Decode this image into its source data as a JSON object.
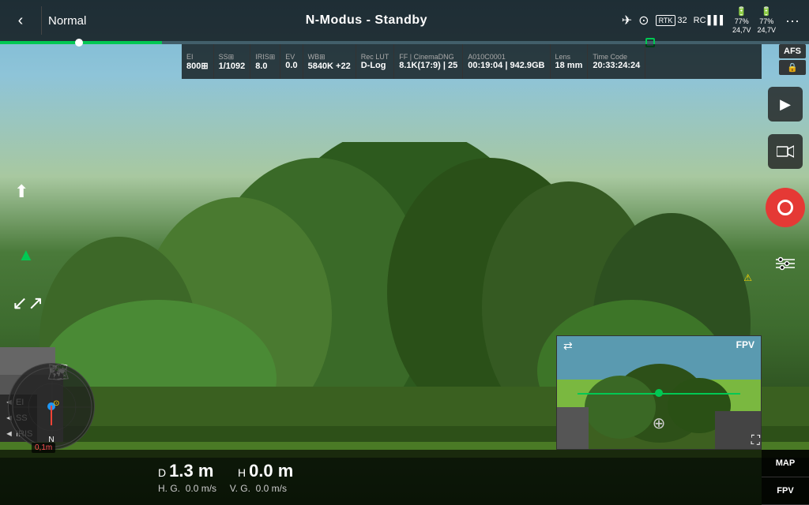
{
  "header": {
    "back_label": "‹",
    "mode_label": "Normal",
    "title": "N-Modus - Standby",
    "rtk_value": "32",
    "rc_label": "RC",
    "battery1_pct": "77%",
    "battery1_v": "24,7V",
    "battery2_pct": "77%",
    "battery2_v": "24,7V",
    "menu_dots": "···"
  },
  "params": {
    "ei_label": "EI",
    "ei_value": "800⊞",
    "ss_label": "SS⊞",
    "ss_value": "1/1092",
    "iris_label": "IRIS⊞",
    "iris_value": "8.0",
    "ev_label": "EV",
    "ev_value": "0.0",
    "wb_label": "WB⊞",
    "wb_value": "5840K +22",
    "reclut_label": "Rec LUT",
    "reclut_value": "D-Log",
    "ff_label": "FF | CinemaDNG",
    "ff_value": "8.1K(17:9) | 25",
    "clip_label": "A010C0001",
    "clip_value": "00:19:04 | 942.9GB",
    "lens_label": "Lens",
    "lens_value": "18 mm",
    "tc_label": "Time Code",
    "tc_value": "20:33:24:24",
    "afs_label": "AFS",
    "ae_lock_icon": "🔒"
  },
  "telemetry": {
    "d_label": "D",
    "d_value": "1.3 m",
    "h_label": "H",
    "h_value": "0.0 m",
    "hg_label": "H. G.",
    "hg_value": "0.0 m/s",
    "vg_label": "V. G.",
    "vg_value": "0.0 m/s",
    "dist_warning": "0,1m"
  },
  "miniview": {
    "label": "FPV",
    "switch_icon": "⇄"
  },
  "map_fpv": {
    "map_label": "MAP",
    "fpv_label": "FPV"
  },
  "icons": {
    "back": "‹",
    "play": "▶",
    "camera": "📷",
    "settings": "⚙",
    "north": "▲",
    "upload": "⬆",
    "route": "↙↗",
    "map": "⊞",
    "record_dot": "●",
    "drone_icon": "✈",
    "gimbal_icon": "⊙",
    "fullscreen": "⛶"
  }
}
